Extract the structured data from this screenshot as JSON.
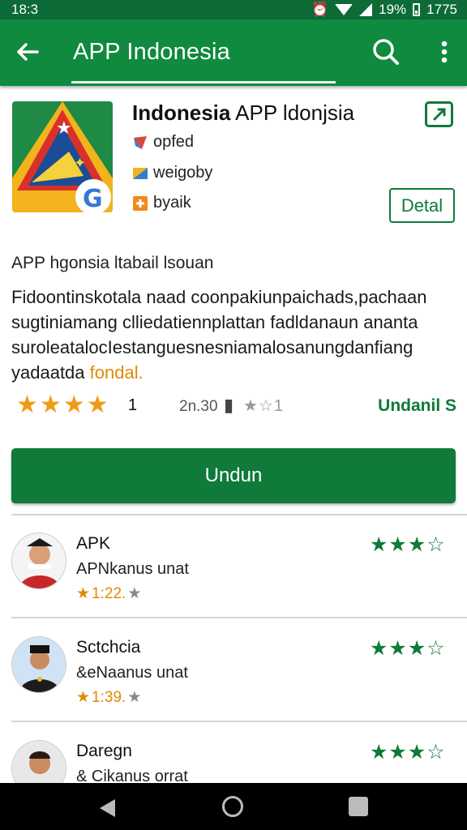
{
  "status_bar": {
    "time": "18:3",
    "battery": "19%",
    "extra": "1775"
  },
  "app_bar": {
    "title": "APP Indonesia"
  },
  "app": {
    "name_bold": "Indonesia",
    "name_rest": " APP ldonjsia",
    "meta": [
      {
        "label": "opfed",
        "color": "#d9463c"
      },
      {
        "label": "weigoby",
        "color": "#2f7fd0"
      },
      {
        "label": "byaik",
        "color": "#f2891c"
      }
    ],
    "detail_label": "Detal"
  },
  "subtitle": "APP hgonsia ltabail lsouan",
  "description": {
    "text": "Fidoontinskotala naad coonpakiunpaichads,pachaan sugtiniamang clliedatiennplattan fadldanaun ananta suroleatalocIestanguesnesniamalosanungdanfiang yadaatda",
    "highlight": "fondal."
  },
  "rating": {
    "value": "1",
    "reviews": "2n.30",
    "small_stars": "★☆1",
    "download_link": "Undanil S"
  },
  "install_label": "Undun",
  "reviews": [
    {
      "name": "APK",
      "subtitle": "APNkanus unat",
      "score": "1:22.",
      "stars": "★★★☆"
    },
    {
      "name": "Sctchcia",
      "subtitle": "&eNaanus unat",
      "score": "1:39.",
      "stars": "★★★☆"
    },
    {
      "name": "Daregn",
      "subtitle": "& Cikanus orrat",
      "score": "",
      "stars": "★★★☆"
    }
  ],
  "colors": {
    "primary": "#0f8a3e",
    "dark_primary": "#0c6b36",
    "accent": "#f29a17"
  }
}
